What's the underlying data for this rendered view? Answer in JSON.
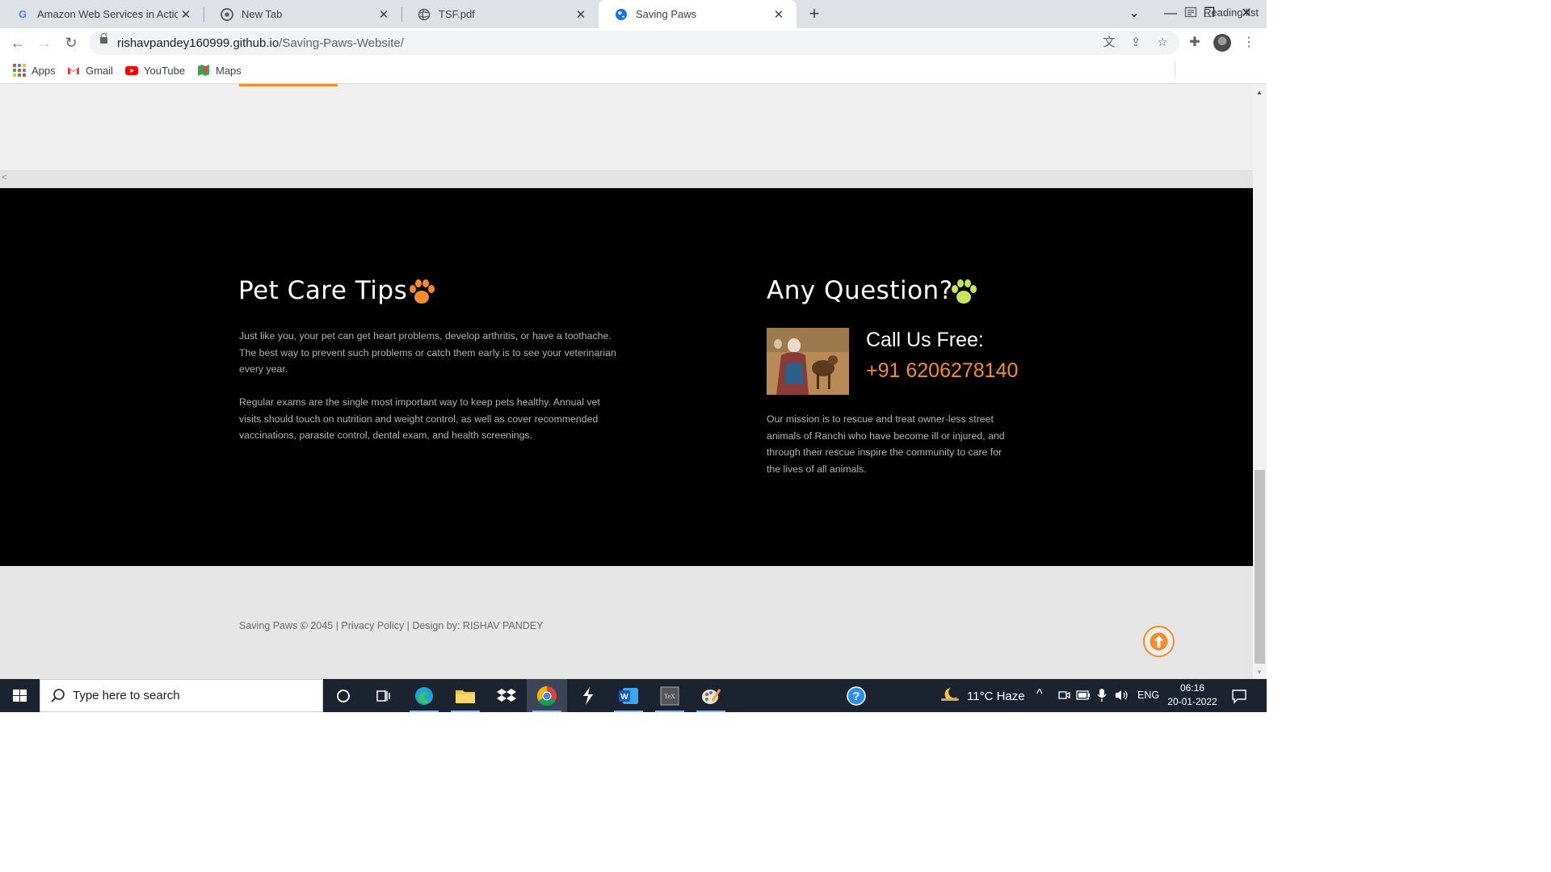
{
  "browser": {
    "tabs": [
      {
        "title": "Amazon Web Services in Action -",
        "favicon": "google-g-icon"
      },
      {
        "title": "New Tab",
        "favicon": "chrome-icon"
      },
      {
        "title": "TSF.pdf",
        "favicon": "globe-icon"
      },
      {
        "title": "Saving Paws",
        "favicon": "globe-icon",
        "active": true
      }
    ],
    "url_host": "rishavpandey160999.github.io",
    "url_path": "/Saving-Paws-Website/",
    "bookmarks": [
      {
        "label": "Apps",
        "icon": "apps-grid-icon"
      },
      {
        "label": "Gmail",
        "icon": "gmail-icon"
      },
      {
        "label": "YouTube",
        "icon": "youtube-icon"
      },
      {
        "label": "Maps",
        "icon": "maps-icon"
      }
    ],
    "reading_list": "Reading list"
  },
  "page": {
    "hscroll_arrow": "<",
    "pet_care": {
      "title": "Pet Care Tips",
      "para1": "Just like you, your pet can get heart problems, develop arthritis, or have a toothache. The best way to prevent such problems or catch them early is to see your veterinarian every year.",
      "para2": "Regular exams are the single most important way to keep pets healthy. Annual vet visits should touch on nutrition and weight control, as well as cover recommended vaccinations, parasite control, dental exam, and health screenings."
    },
    "question": {
      "title": "Any Question?",
      "call_label": "Call Us Free:",
      "phone": "+91 6206278140",
      "mission": "Our mission is to rescue and treat owner-less street animals of Ranchi who have become ill or injured, and through their rescue inspire the community to care for the lives of all animals."
    },
    "footer": "Saving Paws © 2045 | Privacy Policy | Design by: RISHAV PANDEY",
    "colors": {
      "accent": "#f58b2b",
      "paw_green": "#c8e65a",
      "dark_bg": "#000000"
    }
  },
  "taskbar": {
    "search_placeholder": "Type here to search",
    "weather": "11°C  Haze",
    "language": "ENG",
    "time": "06:16",
    "date": "20-01-2022"
  }
}
